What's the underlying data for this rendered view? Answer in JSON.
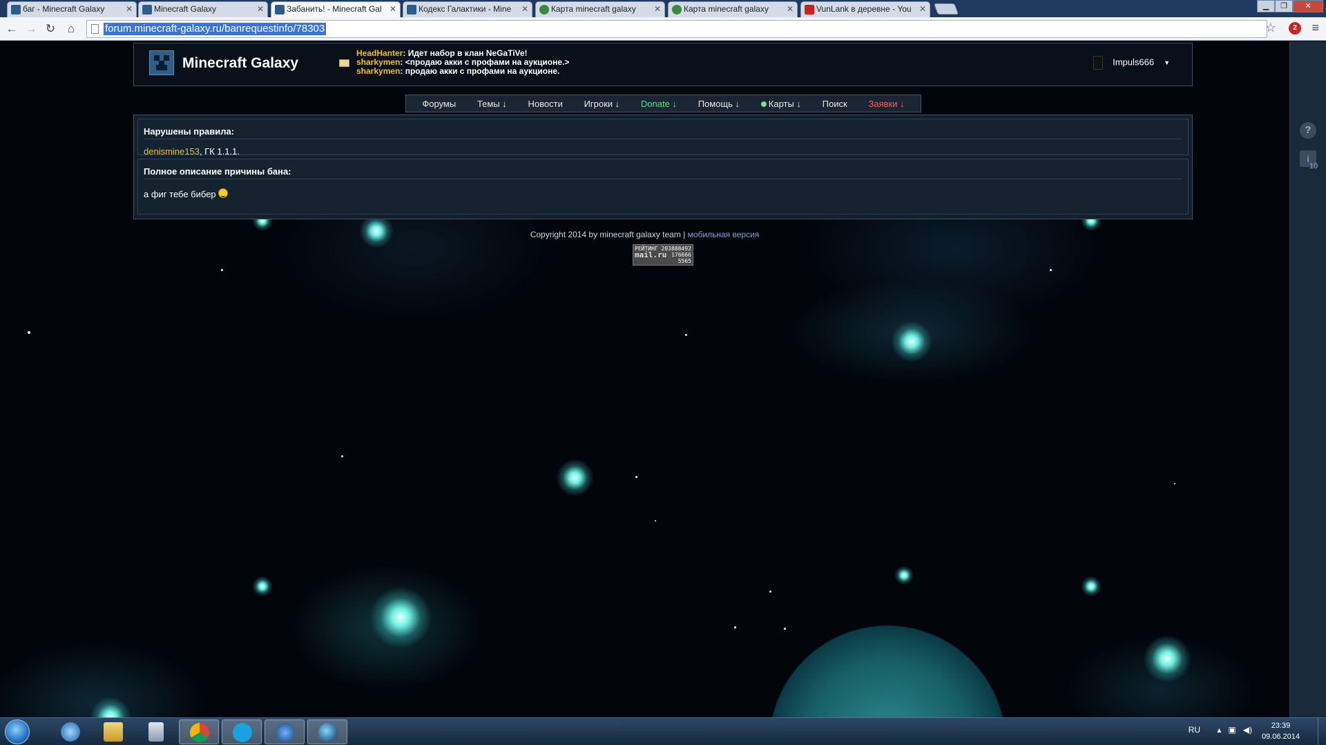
{
  "browser": {
    "tabs": [
      {
        "title": "баг - Minecraft Galaxy",
        "favicon_color": "#2b5d8a",
        "active": false
      },
      {
        "title": "Minecraft Galaxy",
        "favicon_color": "#2b5d8a",
        "active": false
      },
      {
        "title": "Забанить! - Minecraft Gal",
        "favicon_color": "#2b5d8a",
        "active": true
      },
      {
        "title": "Кодекс Галактики - Mine",
        "favicon_color": "#2b5d8a",
        "active": false
      },
      {
        "title": "Карта minecraft galaxy",
        "favicon_color": "#3a8a3a",
        "active": false
      },
      {
        "title": "Карта minecraft galaxy",
        "favicon_color": "#3a8a3a",
        "active": false
      },
      {
        "title": "VunLank в деревне - You",
        "favicon_color": "#cc1f1f",
        "active": false
      }
    ],
    "url": "forum.minecraft-galaxy.ru/banrequestinfo/78303",
    "extension_badge": "2"
  },
  "site": {
    "title": "Minecraft Galaxy",
    "shouts": [
      {
        "author": "HeadHanter",
        "text": ": Идет набор в клан NeGaTiVe!"
      },
      {
        "author": "sharkymen",
        "text": ": <продаю акки с профами на аукционе.>"
      },
      {
        "author": "sharkymen",
        "text": ": продаю акки с профами на аукционе."
      }
    ],
    "username": "Impuls666"
  },
  "nav": {
    "forums": "Форумы",
    "topics": "Темы ↓",
    "news": "Новости",
    "players": "Игроки ↓",
    "donate": "Donate ↓",
    "help": "Помощь ↓",
    "maps": "Карты ↓",
    "search": "Поиск",
    "requests": "Заявки ↓"
  },
  "ban": {
    "rules_title": "Нарушены правила:",
    "user": "denismine153",
    "rules": ", ГК 1.1.1.",
    "reason_title": "Полное описание причины бана:",
    "reason": "а фиг тебе бибер"
  },
  "footer": {
    "copyright": "Copyright 2014 by minecraft galaxy team | ",
    "mobile_link": "мобильная версия",
    "counter_line1": "РЕЙТИНГ 203888492",
    "counter_brand": "mail.ru",
    "counter_line2": "176666",
    "counter_line3": "5565"
  },
  "sidebar": {
    "help_glyph": "?",
    "notif_glyph": "i",
    "notif_count": "10"
  },
  "taskbar": {
    "lang": "RU",
    "time": "23:39",
    "date": "09.06.2014"
  },
  "icons": {
    "back": "arrow-left-icon",
    "forward": "arrow-right-icon",
    "reload": "reload-icon",
    "home": "home-icon",
    "star": "star-icon",
    "menu": "menu-icon",
    "mail": "envelope-icon"
  }
}
